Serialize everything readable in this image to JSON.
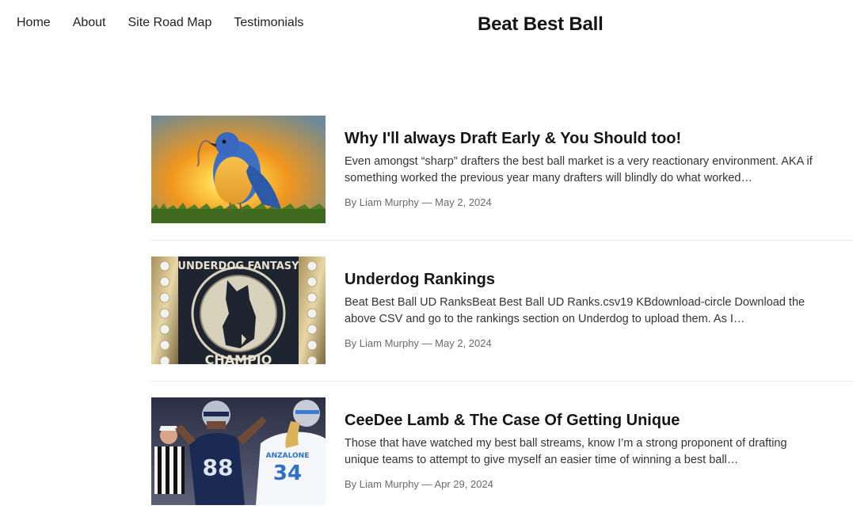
{
  "nav": {
    "items": [
      "Home",
      "About",
      "Site Road Map",
      "Testimonials"
    ]
  },
  "site": {
    "title": "Beat Best Ball"
  },
  "posts": [
    {
      "title": "Why I'll always Draft Early & You Should too!",
      "excerpt": "Even amongst “sharp” drafters the best ball market is a very reactionary environment. AKA if something worked the previous year many drafters will blindly do what worked…",
      "author": "By Liam Murphy",
      "separator": "—",
      "date": "May 2, 2024",
      "image": "early-bird-sunset-image"
    },
    {
      "title": "Underdog Rankings",
      "excerpt": "Beat Best Ball UD RanksBeat Best Ball UD Ranks.csv19 KBdownload-circle Download the above CSV and go to the rankings section on Underdog to upload them. As I…",
      "author": "By Liam Murphy",
      "separator": "—",
      "date": "May 2, 2024",
      "image": "underdog-fantasy-ring-image",
      "image_text": [
        "UNDERDOG FANTASY",
        "CHAMPIO"
      ]
    },
    {
      "title": "CeeDee Lamb & The Case Of Getting Unique",
      "excerpt": "Those that have watched my best ball streams, know I’m a strong proponent of drafting unique teams to attempt to give myself an easier time of winning a best ball…",
      "author": "By Liam Murphy",
      "separator": "—",
      "date": "Apr 29, 2024",
      "image": "football-players-image",
      "image_text": [
        "88",
        "ANZALONE",
        "34"
      ]
    }
  ]
}
